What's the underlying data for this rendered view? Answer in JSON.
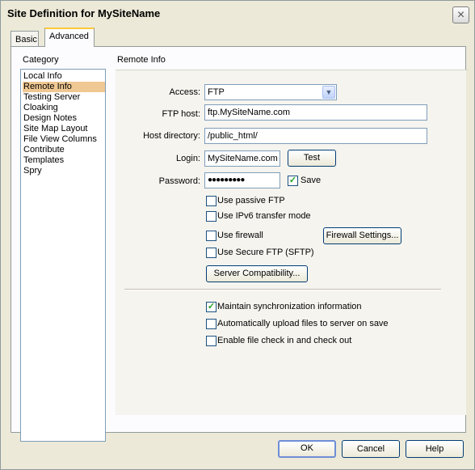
{
  "window": {
    "title": "Site Definition for MySiteName",
    "close_icon": "×"
  },
  "tabs": [
    {
      "label": "Basic"
    },
    {
      "label": "Advanced",
      "active": true
    }
  ],
  "category": {
    "label": "Category",
    "items": [
      {
        "label": "Local Info"
      },
      {
        "label": "Remote Info",
        "selected": true
      },
      {
        "label": "Testing Server"
      },
      {
        "label": "Cloaking"
      },
      {
        "label": "Design Notes"
      },
      {
        "label": "Site Map Layout"
      },
      {
        "label": "File View Columns"
      },
      {
        "label": "Contribute"
      },
      {
        "label": "Templates"
      },
      {
        "label": "Spry"
      }
    ]
  },
  "remote": {
    "section_title": "Remote Info",
    "access_label": "Access:",
    "access_value": "FTP",
    "ftp_host_label": "FTP host:",
    "ftp_host_value": "ftp.MySiteName.com",
    "host_dir_label": "Host directory:",
    "host_dir_value": "/public_html/",
    "login_label": "Login:",
    "login_value": "MySiteName.com",
    "test_button": "Test",
    "password_label": "Password:",
    "password_value": "●●●●●●●●●",
    "save_label": "Save",
    "save_checked": true,
    "passive_ftp": "Use passive FTP",
    "ipv6": "Use IPv6 transfer mode",
    "firewall": "Use firewall",
    "firewall_settings_button": "Firewall Settings...",
    "sftp": "Use Secure FTP (SFTP)",
    "server_compat_button": "Server Compatibility...",
    "maintain_sync": "Maintain synchronization information",
    "maintain_sync_checked": true,
    "auto_upload": "Automatically upload files to server on save",
    "checkin": "Enable file check in and check out"
  },
  "footer": {
    "ok": "OK",
    "cancel": "Cancel",
    "help": "Help"
  },
  "colors": {
    "selection": "#f0c893",
    "tab_highlight": "#ffc83c",
    "check": "#21a121"
  }
}
